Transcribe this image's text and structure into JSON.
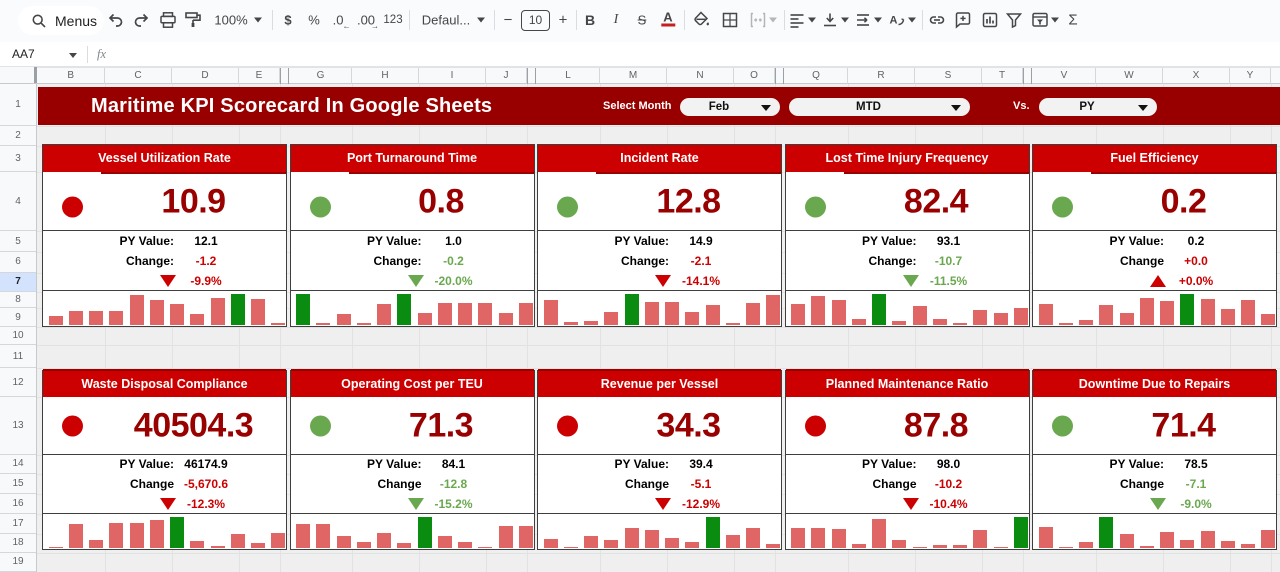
{
  "toolbar": {
    "menus_label": "Menus",
    "zoom_value": "100%",
    "currency_label": "$",
    "percent_label": "%",
    "decimal_decrease_label": ".0",
    "decimal_increase_label": ".00",
    "number_format_label": "123",
    "font_name": "Defaul...",
    "font_size_decrease_label": "−",
    "font_size_value": "10",
    "font_size_increase_label": "+",
    "bold_label": "B",
    "italic_label": "I",
    "strikethrough_label": "S",
    "text_color_label": "A",
    "sum_label": "Σ",
    "icons": [
      "search-icon",
      "undo-icon",
      "redo-icon",
      "print-icon",
      "paint-format-icon",
      "dollar-icon",
      "percent-icon",
      "decrease-decimal-icon",
      "increase-decimal-icon",
      "more-formats-icon",
      "font-dropdown",
      "bold-icon",
      "italic-icon",
      "strikethrough-icon",
      "text-color-icon",
      "fill-color-icon",
      "borders-icon",
      "merge-cells-icon",
      "align-left-icon",
      "vertical-align-icon",
      "text-wrap-icon",
      "text-rotation-icon",
      "insert-link-icon",
      "insert-comment-icon",
      "insert-chart-icon",
      "filter-icon",
      "filter-views-icon",
      "functions-icon"
    ]
  },
  "formula_bar": {
    "cell_reference": "AA7",
    "fx_label": "fx"
  },
  "grid": {
    "column_headers": [
      "B",
      "C",
      "D",
      "E",
      "G",
      "H",
      "I",
      "J",
      "L",
      "M",
      "N",
      "O",
      "Q",
      "R",
      "S",
      "T",
      "V",
      "W",
      "X",
      "Y"
    ],
    "row_headers": [
      "1",
      "2",
      "3",
      "4",
      "5",
      "6",
      "7",
      "8",
      "9",
      "10",
      "11",
      "12",
      "13",
      "14",
      "15",
      "16",
      "17",
      "18",
      "19"
    ],
    "selected_row": "7"
  },
  "banner": {
    "title": "Maritime KPI Scorecard In Google Sheets",
    "select_month_label": "Select Month",
    "month_value": "Feb",
    "period_value": "MTD",
    "vs_label": "Vs.",
    "compare_value": "PY"
  },
  "colors": {
    "banner_bg": "#980000",
    "card_header_bg": "#cc0000",
    "big_number": "#990000",
    "red_dot": "#cc0000",
    "green_dot": "#6aa84f",
    "change_red": "#cc0000",
    "change_green": "#6aa84f",
    "spark_pink": "#e06666",
    "spark_green": "#0a8c10",
    "selected_row_bg": "#d3e3fd"
  },
  "cards": [
    {
      "title": "Vessel Utilization Rate",
      "value": "10.9",
      "dot": "red",
      "py_label": "PY Value:",
      "py_value": "12.1",
      "change_label": "Change:",
      "change_value": "-1.2",
      "change_color": "red",
      "arrow": "down",
      "arrow_color": "red",
      "pct_value": "-9.9%",
      "pct_color": "red",
      "spark": [
        0.27,
        0.42,
        0.45,
        0.43,
        0.95,
        0.78,
        0.65,
        0.35,
        0.85,
        1.0,
        0.82,
        0.04
      ],
      "spark_green_index": 9
    },
    {
      "title": "Port Turnaround Time",
      "value": "0.8",
      "dot": "green",
      "py_label": "PY Value:",
      "py_value": "1.0",
      "change_label": "Change:",
      "change_value": "-0.2",
      "change_color": "green",
      "arrow": "down",
      "arrow_color": "green",
      "pct_value": "-20.0%",
      "pct_color": "green",
      "spark": [
        1.0,
        0.04,
        0.34,
        0.03,
        0.65,
        1.0,
        0.36,
        0.69,
        0.7,
        0.69,
        0.36,
        0.68
      ],
      "spark_green_index": [
        0,
        5
      ]
    },
    {
      "title": "Incident Rate",
      "value": "12.8",
      "dot": "green",
      "py_label": "PY Value:",
      "py_value": "14.9",
      "change_label": "Change:",
      "change_value": "-2.1",
      "change_color": "red",
      "arrow": "down",
      "arrow_color": "red",
      "pct_value": "-14.1%",
      "pct_color": "red",
      "spark": [
        0.78,
        0.09,
        0.11,
        0.39,
        1.0,
        0.72,
        0.72,
        0.39,
        0.63,
        0.04,
        0.69,
        0.94
      ],
      "spark_green_index": 4
    },
    {
      "title": "Lost Time Injury Frequency",
      "value": "82.4",
      "dot": "green",
      "py_label": "PY Value:",
      "py_value": "93.1",
      "change_label": "Change:",
      "change_value": "-10.7",
      "change_color": "green",
      "arrow": "down",
      "arrow_color": "green",
      "pct_value": "-11.5%",
      "pct_color": "green",
      "spark": [
        0.65,
        0.92,
        0.79,
        0.18,
        1.0,
        0.11,
        0.6,
        0.19,
        0.05,
        0.48,
        0.36,
        0.54
      ],
      "spark_green_index": 4
    },
    {
      "title": "Fuel Efficiency",
      "value": "0.2",
      "dot": "green",
      "py_label": "PY Value:",
      "py_value": "0.2",
      "change_label": "Change",
      "change_value": "+0.0",
      "change_color": "red",
      "arrow": "up",
      "arrow_color": "red",
      "pct_value": "+0.0%",
      "pct_color": "red",
      "spark": [
        0.66,
        0.05,
        0.15,
        0.63,
        0.37,
        0.87,
        0.75,
        1.0,
        0.83,
        0.51,
        0.79,
        0.33
      ],
      "spark_green_index": 7
    },
    {
      "title": "Waste Disposal Compliance",
      "value": "40504.3",
      "dot": "red",
      "py_label": "PY Value:",
      "py_value": "46174.9",
      "change_label": "Change",
      "change_value": "-5,670.6",
      "change_color": "red",
      "arrow": "down",
      "arrow_color": "red",
      "pct_value": "-12.3%",
      "pct_color": "red",
      "spark": [
        0.03,
        0.78,
        0.26,
        0.81,
        0.82,
        0.9,
        1.0,
        0.24,
        0.06,
        0.47,
        0.16,
        0.5
      ],
      "spark_green_index": 6
    },
    {
      "title": "Operating Cost per TEU",
      "value": "71.3",
      "dot": "green",
      "py_label": "PY Value:",
      "py_value": "84.1",
      "change_label": "Change",
      "change_value": "-12.8",
      "change_color": "green",
      "arrow": "down",
      "arrow_color": "green",
      "pct_value": "-15.2%",
      "pct_color": "green",
      "spark": [
        0.79,
        0.77,
        0.39,
        0.19,
        0.49,
        0.18,
        1.0,
        0.38,
        0.19,
        0.03,
        0.72,
        0.71
      ],
      "spark_green_index": 6
    },
    {
      "title": "Revenue per Vessel",
      "value": "34.3",
      "dot": "red",
      "py_label": "PY Value:",
      "py_value": "39.4",
      "change_label": "Change",
      "change_value": "-5.1",
      "change_color": "red",
      "arrow": "down",
      "arrow_color": "red",
      "pct_value": "-12.9%",
      "pct_color": "red",
      "spark": [
        0.31,
        0.03,
        0.38,
        0.28,
        0.65,
        0.59,
        0.34,
        0.2,
        1.0,
        0.42,
        0.65,
        0.12
      ],
      "spark_green_index": 8
    },
    {
      "title": "Planned Maintenance Ratio",
      "value": "87.8",
      "dot": "red",
      "py_label": "PY Value:",
      "py_value": "98.0",
      "change_label": "Change",
      "change_value": "-10.2",
      "change_color": "red",
      "arrow": "down",
      "arrow_color": "red",
      "pct_value": "-10.4%",
      "pct_color": "red",
      "spark": [
        0.66,
        0.66,
        0.61,
        0.13,
        0.95,
        0.27,
        0.05,
        0.11,
        0.09,
        0.58,
        0.05,
        1.0
      ],
      "spark_green_index": 11
    },
    {
      "title": "Downtime Due to Repairs",
      "value": "71.4",
      "dot": "green",
      "py_label": "PY Value:",
      "py_value": "78.5",
      "change_label": "Change",
      "change_value": "-7.1",
      "change_color": "green",
      "arrow": "down",
      "arrow_color": "green",
      "pct_value": "-9.0%",
      "pct_color": "green",
      "spark": [
        0.68,
        0.05,
        0.19,
        1.0,
        0.45,
        0.07,
        0.51,
        0.27,
        0.55,
        0.23,
        0.15,
        0.6
      ],
      "spark_green_index": 3
    }
  ]
}
